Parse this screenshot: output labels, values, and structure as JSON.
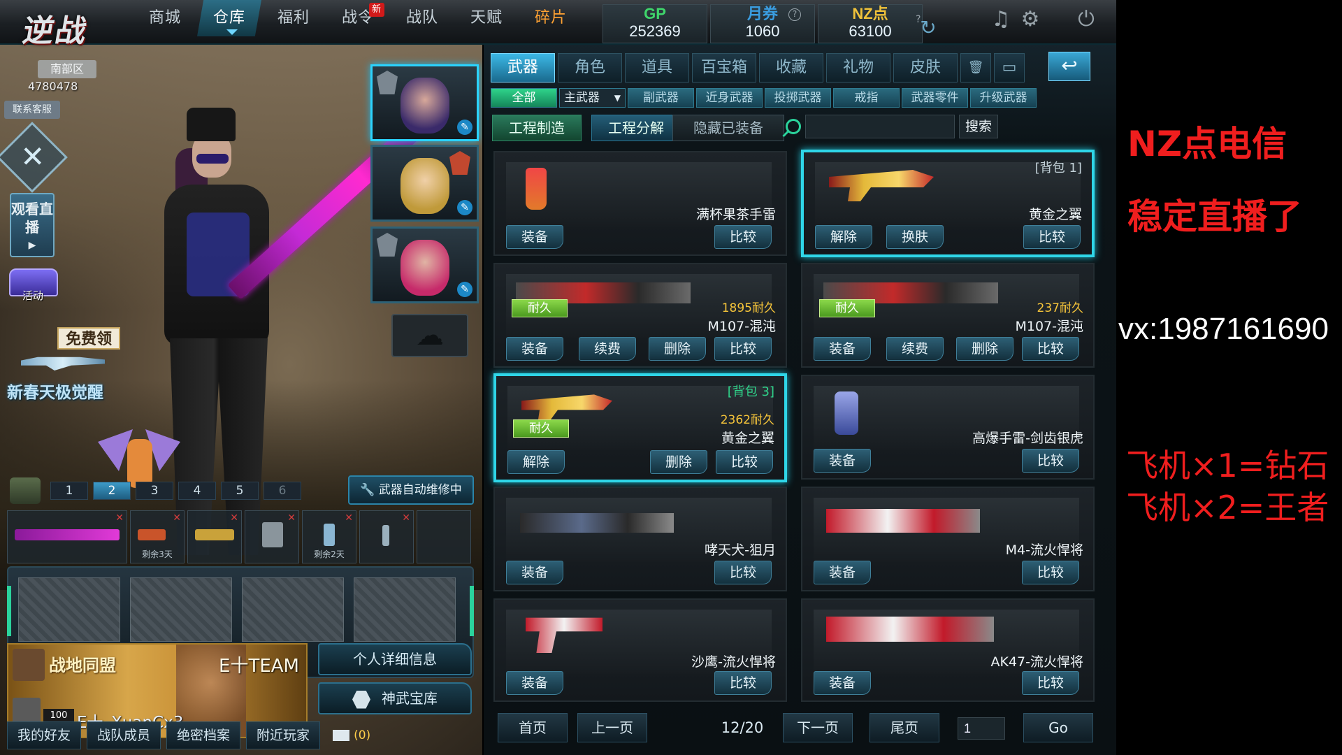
{
  "game": {
    "logo": "逆战",
    "region": "南部区",
    "uid": "4780478"
  },
  "topnav": [
    {
      "label": "商城"
    },
    {
      "label": "仓库"
    },
    {
      "label": "福利"
    },
    {
      "label": "战令",
      "badge": "新"
    },
    {
      "label": "战队"
    },
    {
      "label": "天赋"
    },
    {
      "label": "碎片"
    }
  ],
  "currency": {
    "gp": {
      "label": "GP",
      "value": "252369",
      "color": "#3fd66b"
    },
    "ticket": {
      "label": "月券",
      "value": "1060",
      "color": "#3a9de0"
    },
    "nz": {
      "label": "NZ点",
      "value": "63100",
      "color": "#f0c23a"
    },
    "help": "?"
  },
  "left": {
    "service": "联系客服",
    "watch_live": "观看直播",
    "activity": "活动",
    "free": "免费领",
    "event": "新春天极觉醒",
    "loadout_tabs": [
      "1",
      "2",
      "3",
      "4",
      "5",
      "6"
    ],
    "repair_btn": "武器自动维修中",
    "slot_remaining": [
      "剩余3天",
      "剩余2天"
    ],
    "clan": {
      "banner": "战地同盟",
      "team": "E十TEAM",
      "level": "100",
      "username": "E十_XuanCx3"
    },
    "detail_btn": "个人详细信息",
    "armory_btn": "神武宝库",
    "social": [
      "我的好友",
      "战队成员",
      "绝密档案",
      "附近玩家"
    ],
    "mail_count": "(0)"
  },
  "warehouse": {
    "tabs": [
      "武器",
      "角色",
      "道具",
      "百宝箱",
      "收藏",
      "礼物",
      "皮肤"
    ],
    "subtabs": [
      "全部",
      "主武器",
      "副武器",
      "近身武器",
      "投掷武器",
      "戒指",
      "武器零件",
      "升级武器"
    ],
    "tools": {
      "craft": "工程制造",
      "decompose": "工程分解",
      "hide": "隐藏已装备",
      "search_btn": "搜索",
      "search_value": ""
    },
    "items": [
      {
        "name": "满杯果茶手雷",
        "buttons": [
          "装备",
          "比较"
        ],
        "highlight": false
      },
      {
        "name": "黄金之翼",
        "bag": "[背包 1]",
        "buttons": [
          "解除",
          "换肤",
          "比较"
        ],
        "highlight": true
      },
      {
        "name": "M107-混沌",
        "durability": "1895耐久",
        "tag": "耐久",
        "buttons": [
          "装备",
          "续费",
          "删除",
          "比较"
        ],
        "highlight": false
      },
      {
        "name": "M107-混沌",
        "durability": "237耐久",
        "tag": "耐久",
        "buttons": [
          "装备",
          "续费",
          "删除",
          "比较"
        ],
        "highlight": false
      },
      {
        "name": "黄金之翼",
        "bag": "[背包 3]",
        "durability": "2362耐久",
        "tag": "耐久",
        "buttons": [
          "解除",
          "删除",
          "比较"
        ],
        "highlight": true
      },
      {
        "name": "高爆手雷-剑齿银虎",
        "buttons": [
          "装备",
          "比较"
        ],
        "highlight": false
      },
      {
        "name": "哮天犬-狙月",
        "buttons": [
          "装备",
          "比较"
        ],
        "highlight": false
      },
      {
        "name": "M4-流火悍将",
        "buttons": [
          "装备",
          "比较"
        ],
        "highlight": false
      },
      {
        "name": "沙鹰-流火悍将",
        "buttons": [
          "装备",
          "比较"
        ],
        "highlight": false
      },
      {
        "name": "AK47-流火悍将",
        "buttons": [
          "装备",
          "比较"
        ],
        "highlight": false
      }
    ],
    "pager": {
      "first": "首页",
      "prev": "上一页",
      "info": "12/20",
      "next": "下一页",
      "last": "尾页",
      "page_input": "1",
      "go": "Go"
    }
  },
  "overlay": {
    "line1": "NZ点电信",
    "line2": "稳定直播了",
    "vx": "vx:1987161690",
    "line3": "飞机×1=钻石",
    "line4": "飞机×2=王者"
  }
}
